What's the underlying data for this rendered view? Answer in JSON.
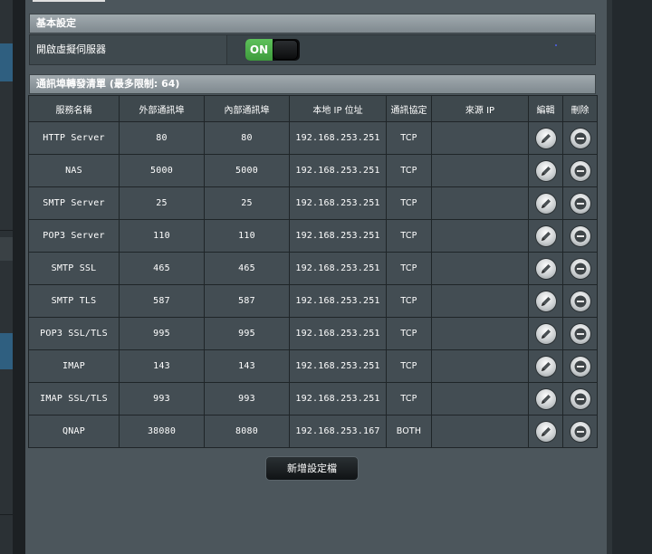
{
  "basic": {
    "header": "基本設定",
    "toggle_label": "開啟虛擬伺服器",
    "toggle_state": "ON"
  },
  "rules": {
    "header": "通訊埠轉發清單 (最多限制: 64)",
    "columns": [
      "服務名稱",
      "外部通訊埠",
      "內部通訊埠",
      "本地 IP 位址",
      "通訊協定",
      "來源 IP",
      "編輯",
      "刪除"
    ],
    "rows": [
      {
        "service": "HTTP Server",
        "ext": "80",
        "int": "80",
        "ip": "192.168.253.251",
        "proto": "TCP",
        "src": ""
      },
      {
        "service": "NAS",
        "ext": "5000",
        "int": "5000",
        "ip": "192.168.253.251",
        "proto": "TCP",
        "src": ""
      },
      {
        "service": "SMTP Server",
        "ext": "25",
        "int": "25",
        "ip": "192.168.253.251",
        "proto": "TCP",
        "src": ""
      },
      {
        "service": "POP3 Server",
        "ext": "110",
        "int": "110",
        "ip": "192.168.253.251",
        "proto": "TCP",
        "src": ""
      },
      {
        "service": "SMTP SSL",
        "ext": "465",
        "int": "465",
        "ip": "192.168.253.251",
        "proto": "TCP",
        "src": ""
      },
      {
        "service": "SMTP TLS",
        "ext": "587",
        "int": "587",
        "ip": "192.168.253.251",
        "proto": "TCP",
        "src": ""
      },
      {
        "service": "POP3 SSL/TLS",
        "ext": "995",
        "int": "995",
        "ip": "192.168.253.251",
        "proto": "TCP",
        "src": ""
      },
      {
        "service": "IMAP",
        "ext": "143",
        "int": "143",
        "ip": "192.168.253.251",
        "proto": "TCP",
        "src": ""
      },
      {
        "service": "IMAP SSL/TLS",
        "ext": "993",
        "int": "993",
        "ip": "192.168.253.251",
        "proto": "TCP",
        "src": ""
      },
      {
        "service": "QNAP",
        "ext": "38080",
        "int": "8080",
        "ip": "192.168.253.167",
        "proto": "BOTH",
        "src": ""
      }
    ]
  },
  "add_button_label": "新增設定檔",
  "colors": {
    "toggle_on": "#4caf50",
    "panel": "#4c565c"
  }
}
